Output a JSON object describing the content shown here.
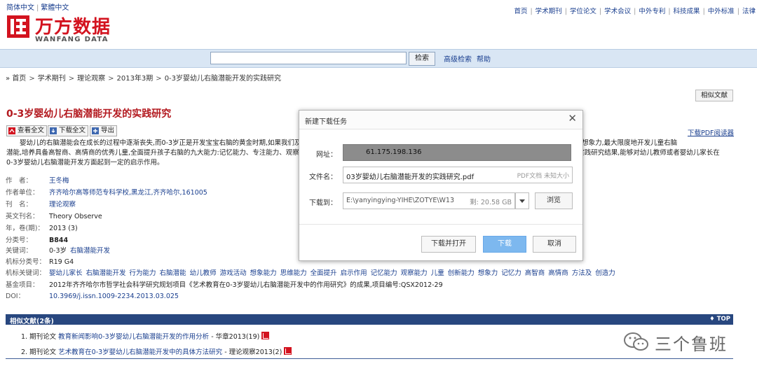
{
  "lang": {
    "simplified": "简体中文",
    "traditional": "繁體中文"
  },
  "topnav": [
    "首页",
    "学术期刊",
    "学位论文",
    "学术会议",
    "中外专利",
    "科技成果",
    "中外标准",
    "法律"
  ],
  "logo": {
    "cn": "万方数据",
    "en": "WANFANG DATA"
  },
  "search": {
    "button": "检索",
    "advanced": "高级检索",
    "help": "帮助"
  },
  "breadcrumb": [
    "首页",
    "学术期刊",
    "理论观察",
    "2013年3期",
    "0-3岁婴幼儿右脑潜能开发的实践研究"
  ],
  "related_button": "相似文献",
  "paper": {
    "title": "0-3岁婴幼儿右脑潜能开发的实践研究",
    "pdf_reader": "下载PDF阅读器",
    "actions": {
      "view": "查看全文",
      "download": "下载全文",
      "export": "导出"
    },
    "abstract_1": "婴幼儿的右脑潜能会在成长的过程中逐渐丧失,而0-3岁正是开发宝宝右脑的黄金时期,如果我们及时",
    "abstract_1_tail": "记忆力、创造力和想象力,最大限度地开发儿童右脑",
    "abstract_2": "潜能,培养具备高智商、高情商的优秀儿童,全面提升孩子右脑的九大能力:记忆能力、专注能力、观察",
    "abstract_2_tail": "的实践研究结果,能够对幼儿教师或者婴幼儿家长在",
    "abstract_3": "0-3岁婴幼儿右脑潜能开发方面起到一定的启示作用。"
  },
  "meta": {
    "author": {
      "label": "作　者：",
      "value": "王冬梅"
    },
    "affiliation": {
      "label": "作者单位：",
      "value": "齐齐哈尔高等师范专科学校,黑龙江,齐齐哈尔,161005"
    },
    "journal": {
      "label": "刊　名：",
      "value": "理论观察"
    },
    "journal_en": {
      "label": "英文刊名：",
      "value": "Theory Observe"
    },
    "year_issue": {
      "label": "年，卷(期)：",
      "value": "2013 (3)"
    },
    "class_no": {
      "label": "分类号：",
      "value": "B844"
    },
    "keywords": {
      "label": "关键词：",
      "values": [
        "0-3岁",
        "右脑潜能开发"
      ]
    },
    "machine_class": {
      "label": "机标分类号：",
      "value": "R19 G4"
    },
    "machine_keywords": {
      "label": "机标关键词：",
      "values": [
        "婴幼儿家长",
        "右脑潜能开发",
        "行为能力",
        "右脑潜能",
        "幼儿教师",
        "游戏活动",
        "想象能力",
        "思维能力",
        "全面提升",
        "启示作用",
        "记忆能力",
        "观察能力",
        "儿童",
        "创新能力",
        "想象力",
        "记忆力",
        "高智商",
        "高情商",
        "方法及",
        "创造力"
      ]
    },
    "fund": {
      "label": "基金项目：",
      "value": "2012年齐齐哈尔市哲学社会科学研究规划项目《艺术教育在0-3岁婴幼儿右脑潜能开发中的作用研究》的成果,项目编号:QSX2012-29"
    },
    "doi": {
      "label": "DOI：",
      "value": "10.3969/j.issn.1009-2234.2013.03.025"
    }
  },
  "related": {
    "header": "相似文献(2条)",
    "top": "♦ TOP",
    "items": [
      {
        "num": "1.",
        "type": "期刊论文",
        "title": "教育新闻影响0-3岁婴幼儿右脑潜能开发的作用分析",
        "source": " - 华章2013(19)"
      },
      {
        "num": "2.",
        "type": "期刊论文",
        "title": "艺术教育在0-3岁婴幼儿右脑潜能开发中的具体方法研究",
        "source": " - 理论观察2013(2)"
      }
    ]
  },
  "watermark": "三个鲁班",
  "dialog": {
    "title": "新建下载任务",
    "url_label": "网址：",
    "url_value": "61.175.198.136",
    "filename_label": "文件名：",
    "filename_value": "03岁婴幼儿右脑潜能开发的实践研究.pdf",
    "filename_meta": "PDF文档  未知大小",
    "path_label": "下载到：",
    "path_value": "E:\\yanyingying-YIHE\\ZOTYE\\W13",
    "path_free": "剩: 20.58 GB",
    "browse": "浏览",
    "btn_download_open": "下载并打开",
    "btn_download": "下载",
    "btn_cancel": "取消"
  }
}
